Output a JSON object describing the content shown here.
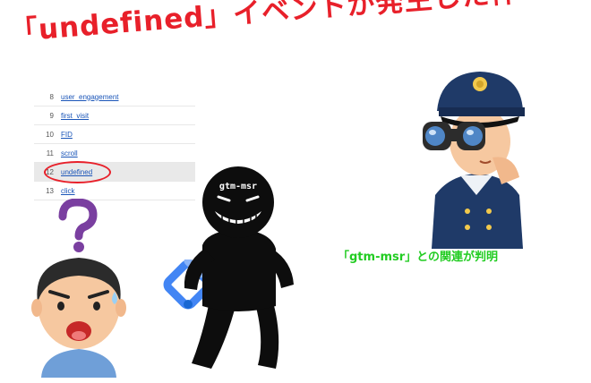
{
  "headline": "「undefined」イベントが発生した件",
  "events_table": {
    "rows": [
      {
        "index": "8",
        "event": "user_engagement"
      },
      {
        "index": "9",
        "event": "first_visit"
      },
      {
        "index": "10",
        "event": "FID"
      },
      {
        "index": "11",
        "event": "scroll"
      },
      {
        "index": "12",
        "event": "undefined",
        "highlighted": true
      },
      {
        "index": "13",
        "event": "click"
      }
    ]
  },
  "thief": {
    "shirt_text": "gtm-msr"
  },
  "tagline": "「gtm-msr」との関連が判明",
  "colors": {
    "headline": "#e8202a",
    "tagline": "#22cc22",
    "link": "#1a55b8",
    "highlight_ring": "#e8202a",
    "question_mark": "#7a3fa0",
    "gtm_blue": "#4285f4",
    "gtm_light_blue": "#8ab4f8"
  },
  "icons": [
    "question-mark-icon",
    "gtm-logo-icon",
    "binoculars-icon",
    "police-badge-icon"
  ]
}
